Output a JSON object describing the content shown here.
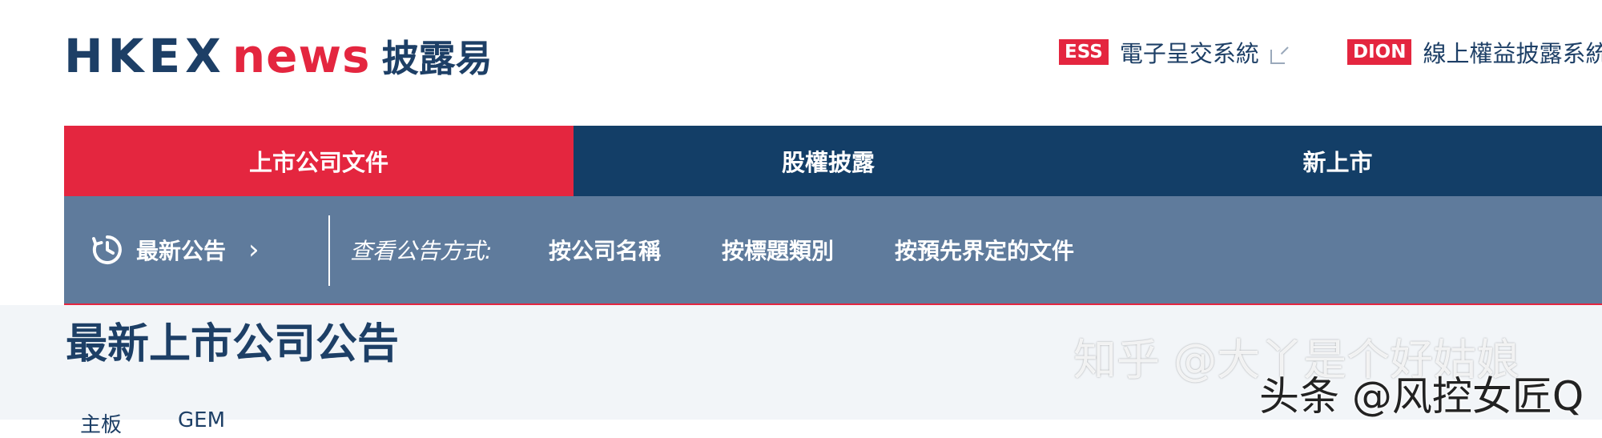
{
  "header": {
    "logo": {
      "hkex": "HKEX",
      "news": "news",
      "chinese": "披露易"
    },
    "external_links": [
      {
        "badge": "ESS",
        "label": "電子呈交系統"
      },
      {
        "badge": "DION",
        "label": "線上權益披露系統"
      }
    ]
  },
  "main_nav": {
    "tabs": [
      {
        "label": "上市公司文件",
        "active": true
      },
      {
        "label": "股權披露",
        "active": false
      },
      {
        "label": "新上市",
        "active": false
      }
    ]
  },
  "sub_nav": {
    "latest_label": "最新公告",
    "view_by_label": "查看公告方式:",
    "links": [
      "按公司名稱",
      "按標題類別",
      "按預先界定的文件"
    ]
  },
  "main": {
    "title": "最新上市公司公告",
    "board_tabs": [
      "主板",
      "GEM"
    ]
  },
  "watermarks": {
    "zhihu": "知乎 @大丫是个好姑娘",
    "toutiao": "头条 @风控女匠Q"
  },
  "colors": {
    "brand_navy": "#133e67",
    "brand_red": "#e4263f",
    "subnav_bg": "#5f7b9c",
    "content_bg": "#f2f5f8"
  }
}
